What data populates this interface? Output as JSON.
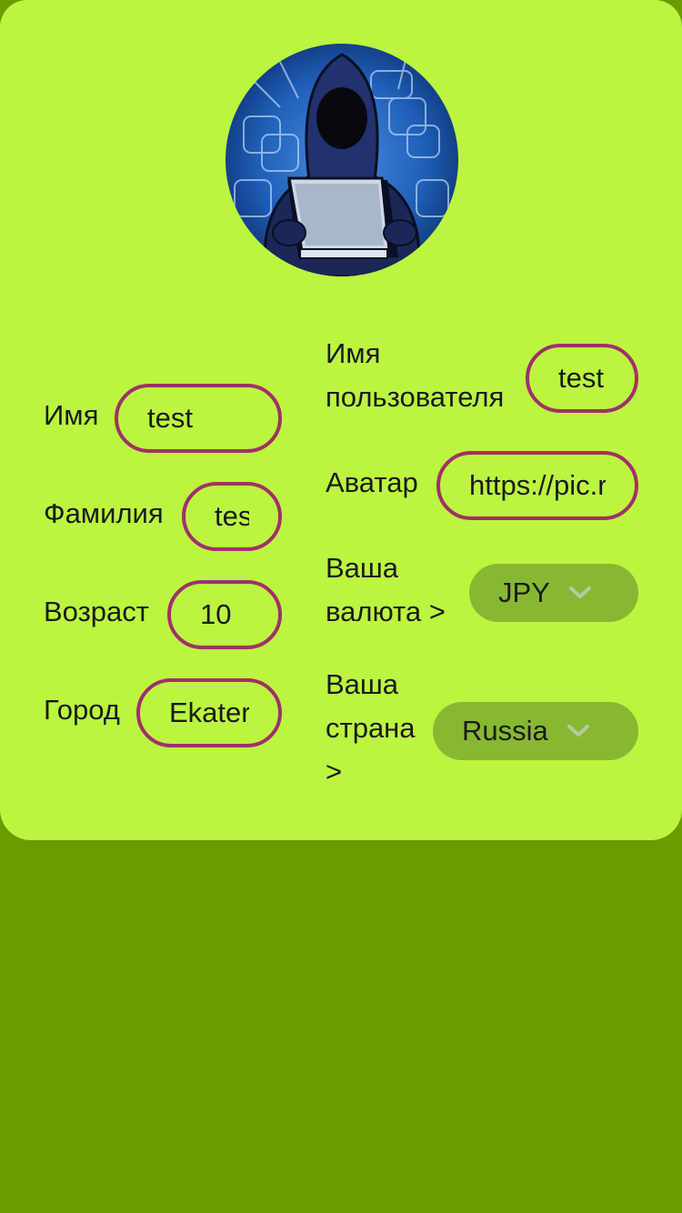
{
  "profile": {
    "avatar_icon": "hooded-hacker-avatar",
    "fields": {
      "first_name": {
        "label": "Имя",
        "value": "test"
      },
      "last_name": {
        "label": "Фамилия",
        "value": "test"
      },
      "age": {
        "label": "Возраст",
        "value": "10"
      },
      "city": {
        "label": "Город",
        "value": "Ekaterinburg"
      },
      "username": {
        "label_line1": "Имя",
        "label_line2": "пользователя",
        "value": "test"
      },
      "avatar_url": {
        "label": "Аватар",
        "value": "https://pic.ru"
      }
    },
    "currency": {
      "label_line1": "Ваша",
      "label_line2": "валюта >",
      "selected": "JPY",
      "icon": "chevron-down-icon"
    },
    "country": {
      "label_line1": "Ваша",
      "label_line2": "страна",
      "label_line3": ">",
      "selected": "Russia",
      "icon": "chevron-down-icon"
    }
  },
  "colors": {
    "page_bg": "#6a9c00",
    "card_bg": "#bbf53f",
    "field_border": "#a0306a",
    "select_bg": "#88b832"
  }
}
